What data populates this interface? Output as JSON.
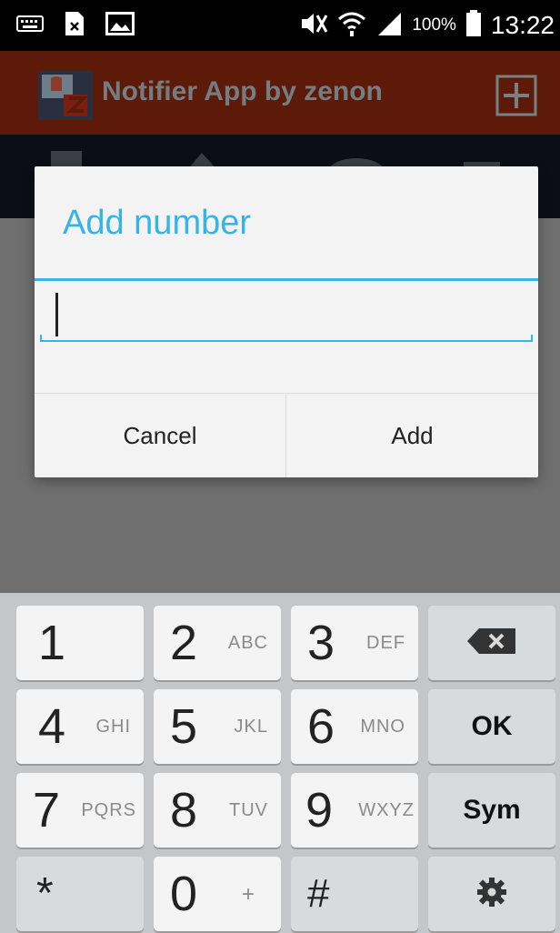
{
  "status_bar": {
    "battery_text": "100%",
    "time": "13:22",
    "icons": [
      "keyboard-icon",
      "sim-blocked-icon",
      "image-icon",
      "mute-icon",
      "wifi-icon",
      "signal-icon",
      "battery-icon"
    ]
  },
  "app_bar": {
    "title": "Notifier App by zenon",
    "colors": {
      "background": "#5e1a09",
      "title": "#747d82"
    }
  },
  "dialog": {
    "title": "Add number",
    "input_value": "",
    "cancel_label": "Cancel",
    "add_label": "Add",
    "accent_color": "#35b5e5"
  },
  "keypad": {
    "keys": [
      {
        "num": "1",
        "sub": ""
      },
      {
        "num": "2",
        "sub": "ABC"
      },
      {
        "num": "3",
        "sub": "DEF"
      },
      {
        "num": "4",
        "sub": "GHI"
      },
      {
        "num": "5",
        "sub": "JKL"
      },
      {
        "num": "6",
        "sub": "MNO"
      },
      {
        "num": "7",
        "sub": "PQRS"
      },
      {
        "num": "8",
        "sub": "TUV"
      },
      {
        "num": "9",
        "sub": "WXYZ"
      },
      {
        "num": "*",
        "sub": ""
      },
      {
        "num": "0",
        "sub": "+"
      },
      {
        "num": "#",
        "sub": ""
      }
    ],
    "ok_label": "OK",
    "sym_label": "Sym"
  }
}
